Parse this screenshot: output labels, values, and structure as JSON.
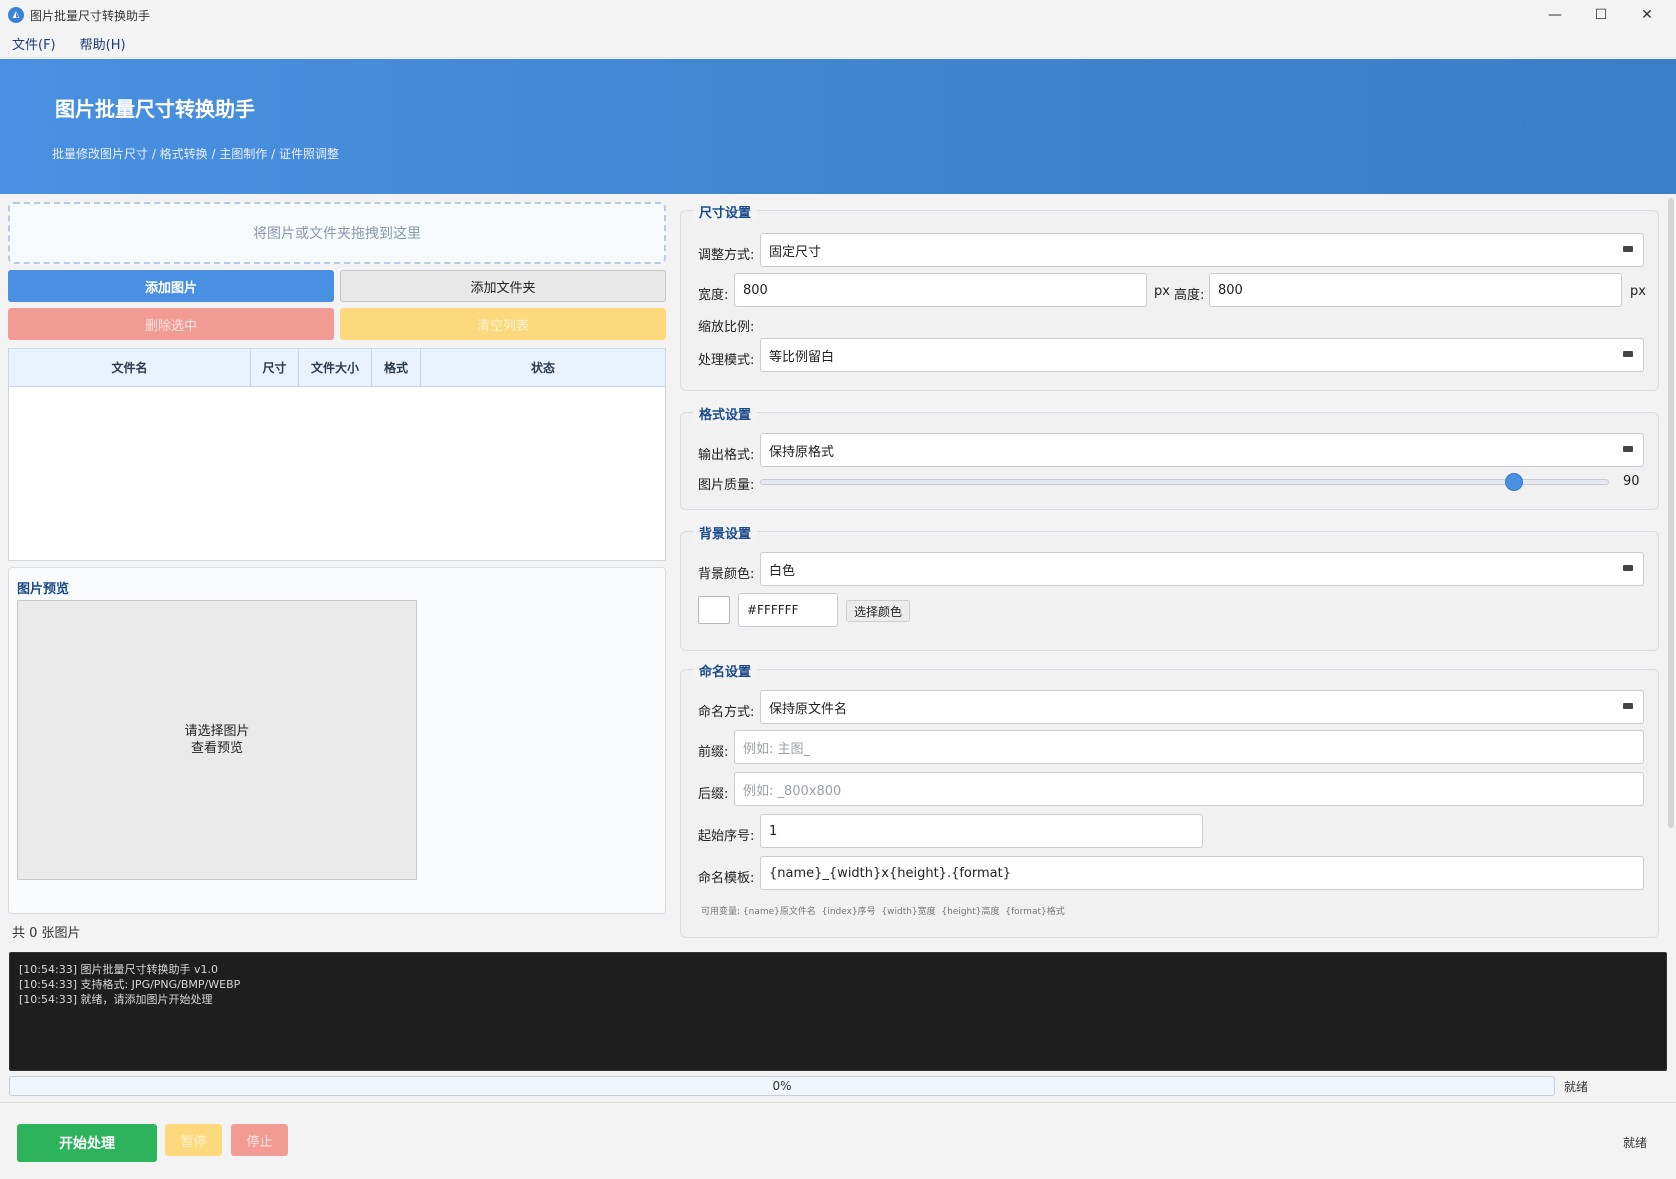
{
  "window": {
    "title": "图片批量尺寸转换助手",
    "icon": "app-icon",
    "min_symbol": "—",
    "max_symbol": "☐",
    "close_symbol": "✕"
  },
  "menu": {
    "file": "文件(F)",
    "help": "帮助(H)"
  },
  "header": {
    "title": "图片批量尺寸转换助手",
    "subtitle": "批量修改图片尺寸 / 格式转换 / 主图制作 / 证件照调整",
    "gradient_start": "#4a90e2",
    "gradient_end": "#3a7ec8"
  },
  "left": {
    "dropzone_text": "将图片或文件夹拖拽到这里",
    "add_images": "添加图片",
    "add_folder": "添加文件夹",
    "delete_selected": "删除选中",
    "clear_list": "清空列表",
    "columns": [
      "文件名",
      "尺寸",
      "文件大小",
      "格式",
      "状态"
    ],
    "rows": [],
    "preview_title": "图片预览",
    "preview_line1": "请选择图片",
    "preview_line2": "查看预览",
    "count_text": "共 0 张图片"
  },
  "size_settings": {
    "title": "尺寸设置",
    "mode_label": "调整方式:",
    "mode_value": "固定尺寸",
    "width_label": "宽度:",
    "width_value": "800",
    "unit1": "px",
    "height_label": "高度:",
    "height_value": "800",
    "unit2": "px",
    "scale_label": "缩放比例:",
    "process_label": "处理模式:",
    "process_value": "等比例留白"
  },
  "format_settings": {
    "title": "格式设置",
    "output_label": "输出格式:",
    "output_value": "保持原格式",
    "quality_label": "图片质量:",
    "quality_value": "90",
    "quality_fraction": 0.888
  },
  "background_settings": {
    "title": "背景设置",
    "color_label": "背景颜色:",
    "color_value": "白色",
    "hex_value": "#FFFFFF",
    "choose_color": "选择颜色",
    "swatch_color": "#FFFFFF"
  },
  "naming_settings": {
    "title": "命名设置",
    "mode_label": "命名方式:",
    "mode_value": "保持原文件名",
    "prefix_label": "前缀:",
    "prefix_placeholder": "例如: 主图_",
    "suffix_label": "后缀:",
    "suffix_placeholder": "例如: _800x800",
    "start_label": "起始序号:",
    "start_value": "1",
    "template_label": "命名模板:",
    "template_value": "{name}_{width}x{height}.{format}",
    "vars_hint": "可用变量: {name}原文件名  {index}序号  {width}宽度  {height}高度  {format}格式"
  },
  "log": {
    "lines": [
      "[10:54:33] 图片批量尺寸转换助手 v1.0",
      "[10:54:33] 支持格式: JPG/PNG/BMP/WEBP",
      "[10:54:33] 就绪，请添加图片开始处理"
    ]
  },
  "progress": {
    "percent_text": "0%",
    "percent": 0,
    "status": "就绪"
  },
  "bottom": {
    "start": "开始处理",
    "pause": "暂停",
    "stop": "停止",
    "status": "就绪"
  },
  "colors": {
    "primary": "#4a90e2",
    "danger": "#f29b94",
    "warning": "#fbd97c",
    "success": "#2db35c",
    "group_title": "#1a4a8a"
  }
}
